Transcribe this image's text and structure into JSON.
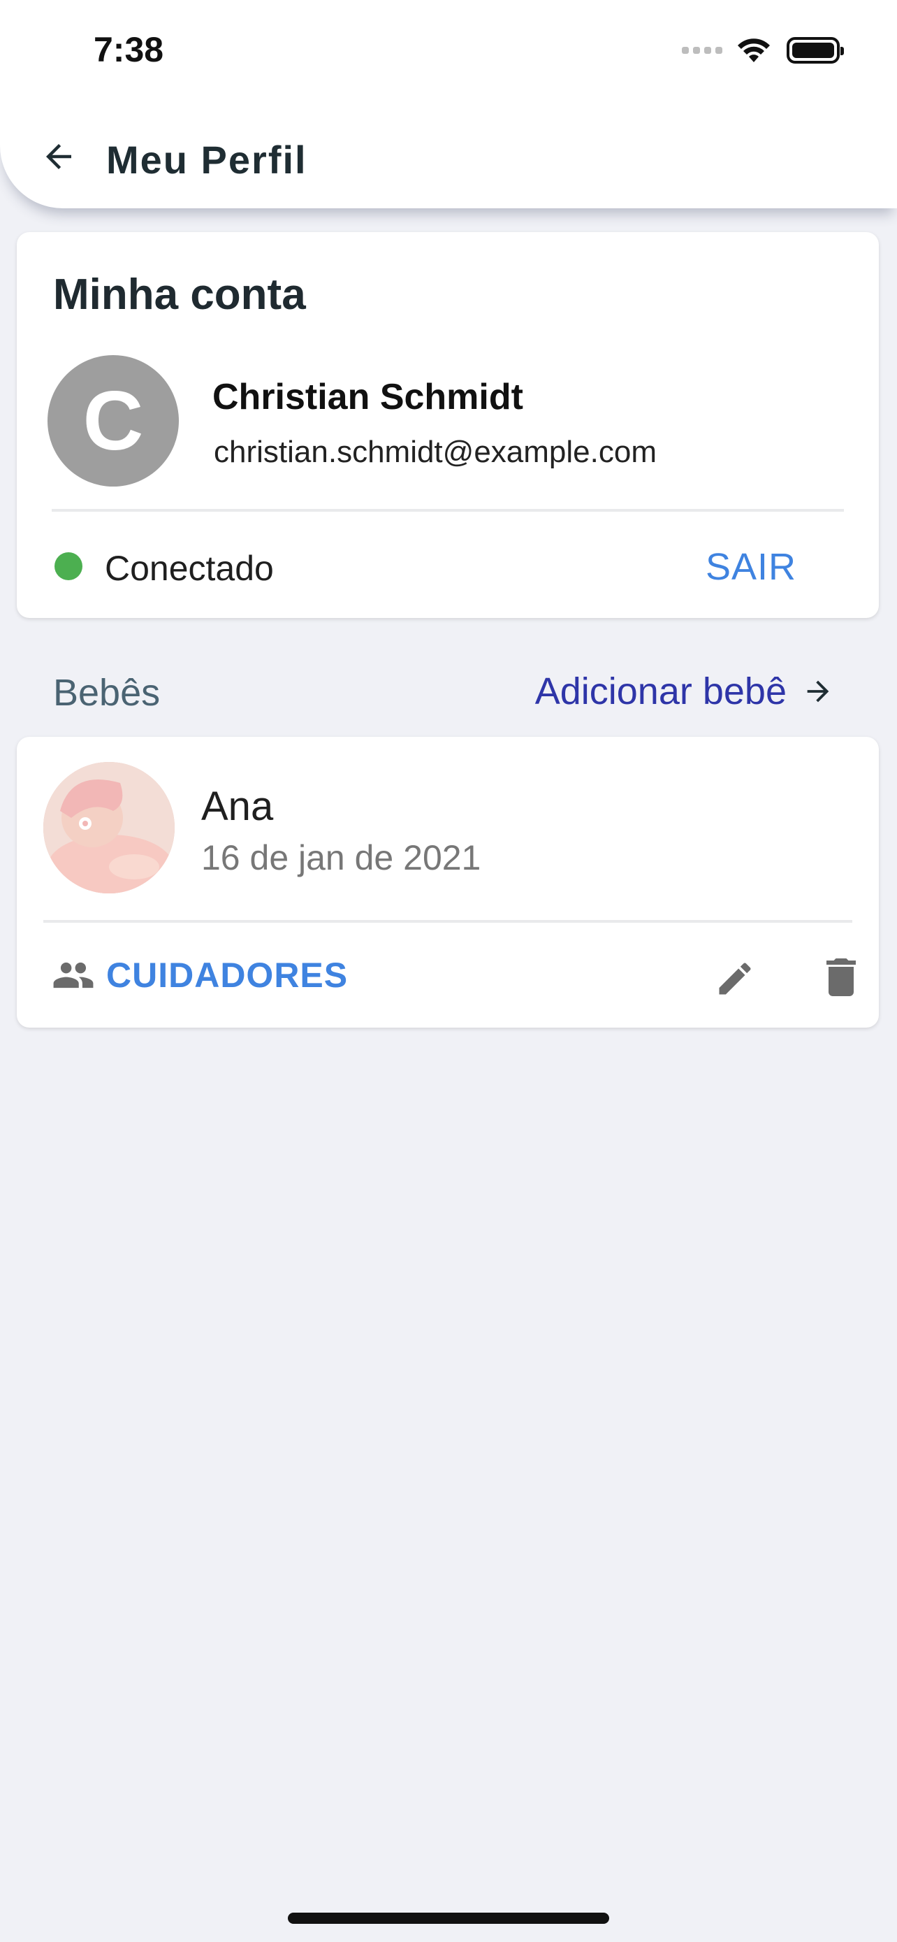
{
  "status_bar": {
    "time": "7:38"
  },
  "app_bar": {
    "title": "Meu Perfil",
    "back_icon": "arrow-left-icon"
  },
  "account": {
    "section_title": "Minha conta",
    "avatar_letter": "C",
    "name": "Christian Schmidt",
    "email": "christian.schmidt@example.com",
    "status_label": "Conectado",
    "status_color": "#4caf50",
    "logout_label": "SAIR"
  },
  "babies": {
    "section_title": "Bebês",
    "add_label": "Adicionar bebê",
    "items": [
      {
        "name": "Ana",
        "birthdate": "16 de jan de 2021",
        "caregivers_label": "CUIDADORES"
      }
    ]
  },
  "colors": {
    "accent": "#3f83e0",
    "link": "#2e35a8",
    "background": "#f0f1f6"
  }
}
